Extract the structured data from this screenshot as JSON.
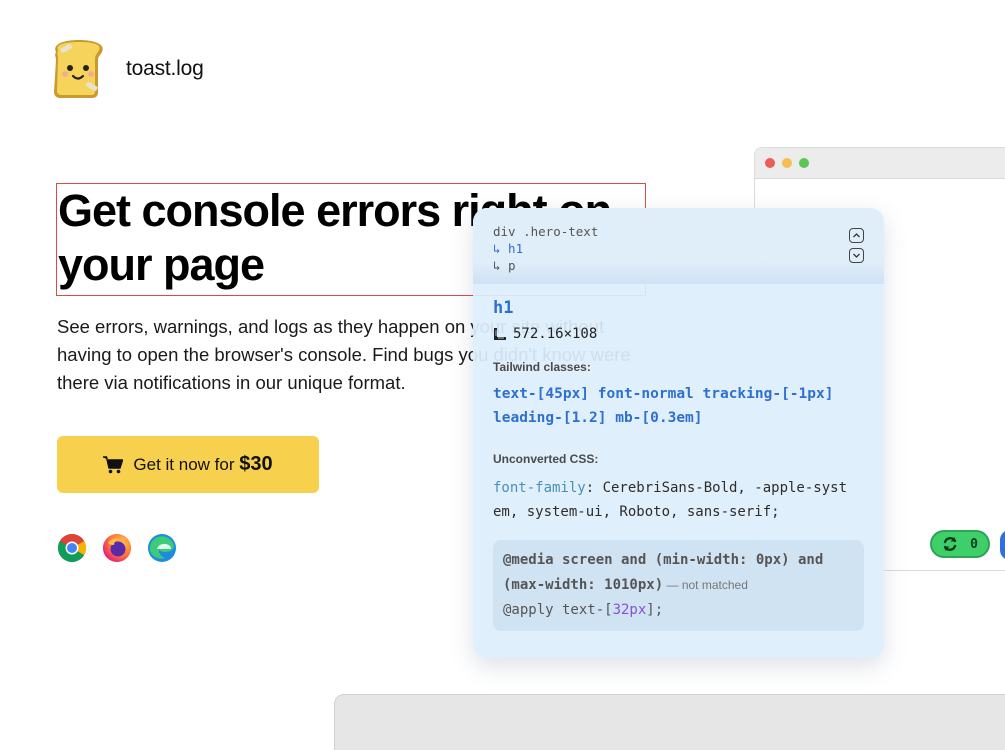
{
  "brand": {
    "name": "toast.log"
  },
  "hero": {
    "title": "Get console errors right on your page",
    "description": "See errors, warnings, and logs as they happen on your site without having to open the browser's console. Find bugs you didn't know were there via notifications in our unique format.",
    "cta_prefix": "Get it now for ",
    "cta_price": "$30"
  },
  "browsers": [
    "chrome-icon",
    "firefox-icon",
    "edge-icon"
  ],
  "mock": {
    "counter": "0"
  },
  "inspector": {
    "breadcrumb_root": "div .hero-text",
    "breadcrumb_child1": "↳ h1",
    "breadcrumb_child2": "↳ p",
    "tag": "h1",
    "dimensions": "572.16×108",
    "tailwind_label": "Tailwind classes:",
    "tailwind_line1": "text-[45px] font-normal tracking-[-1px]",
    "tailwind_line2": "leading-[1.2] mb-[0.3em]",
    "unconverted_label": "Unconverted CSS:",
    "css_prop": "font-family",
    "css_value_1": ": CerebriSans-Bold, -apple-syst",
    "css_value_2": "em, system-ui, Roboto, sans-serif;",
    "media_line1": "@media screen and (min-width: 0px) and",
    "media_line2": "(max-width: 1010px)",
    "media_note": " — not matched",
    "apply_prefix": "@apply text-[",
    "apply_value": "32px",
    "apply_suffix": "];"
  },
  "colors": {
    "accent": "#f7d04e",
    "selection": "#2f6fd0",
    "counter": "#3fcf6a"
  }
}
